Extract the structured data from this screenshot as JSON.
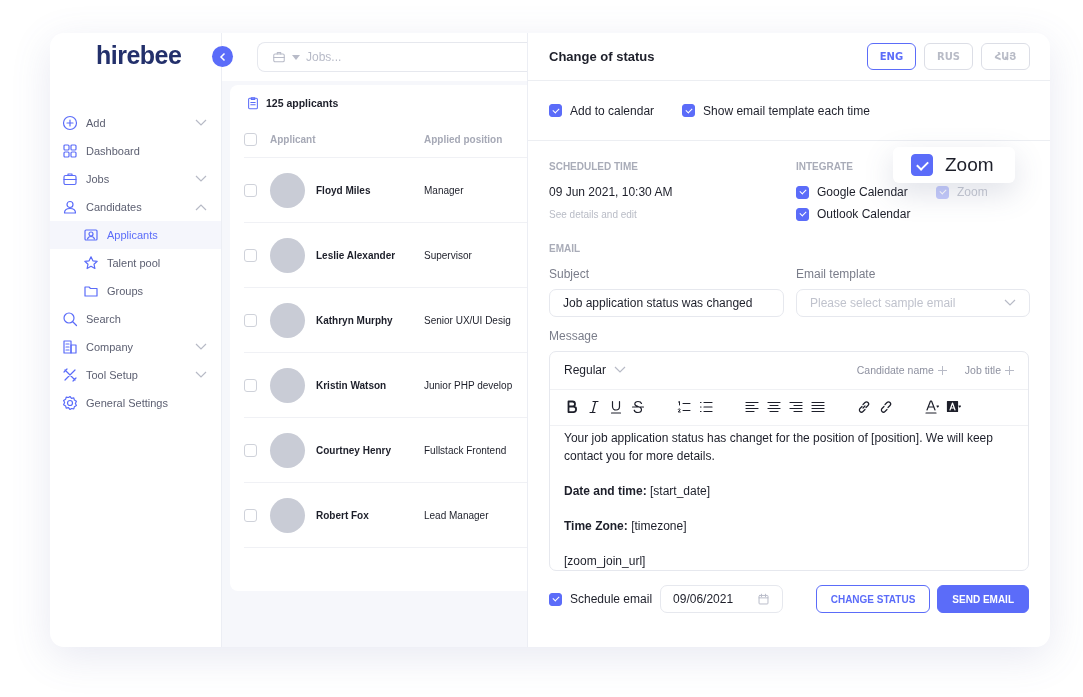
{
  "sidebar": {
    "logo": "hirebee",
    "items": [
      {
        "label": "Add",
        "kind": "group",
        "expanded": false,
        "selected": false
      },
      {
        "label": "Dashboard",
        "kind": "link",
        "selected": false
      },
      {
        "label": "Jobs",
        "kind": "group",
        "expanded": false,
        "selected": false
      },
      {
        "label": "Candidates",
        "kind": "group",
        "expanded": true,
        "selected": false,
        "children": [
          {
            "label": "Applicants",
            "selected": true
          },
          {
            "label": "Talent pool",
            "selected": false
          },
          {
            "label": "Groups",
            "selected": false
          }
        ]
      },
      {
        "label": "Search",
        "kind": "link",
        "selected": false
      },
      {
        "label": "Company",
        "kind": "group",
        "expanded": false,
        "selected": false
      },
      {
        "label": "Tool Setup",
        "kind": "group",
        "expanded": false,
        "selected": false
      },
      {
        "label": "General Settings",
        "kind": "link",
        "selected": false
      }
    ]
  },
  "search": {
    "placeholder": "Jobs..."
  },
  "table": {
    "count": "125 applicants",
    "all_checked": false,
    "columns": [
      "Applicant",
      "Applied position"
    ],
    "rows": [
      {
        "name": "Floyd Miles",
        "position": "Manager",
        "checked": false
      },
      {
        "name": "Leslie Alexander",
        "position": "Supervisor",
        "checked": false
      },
      {
        "name": "Kathryn Murphy",
        "position": "Senior UX/UI Desig",
        "checked": false
      },
      {
        "name": "Kristin Watson",
        "position": "Junior PHP develop",
        "checked": false
      },
      {
        "name": "Courtney Henry",
        "position": "Fullstack Frontend",
        "checked": false
      },
      {
        "name": "Robert Fox",
        "position": "Lead Manager",
        "checked": false
      }
    ]
  },
  "panel": {
    "title": "Change of status",
    "languages": [
      {
        "label": "ENG",
        "selected": true
      },
      {
        "label": "RUS",
        "selected": false
      },
      {
        "label": "ՀԱՅ",
        "selected": false
      }
    ],
    "options": [
      {
        "label": "Add to calendar",
        "checked": true
      },
      {
        "label": "Show email template each time",
        "checked": true
      }
    ],
    "scheduled": {
      "heading": "SCHEDULED TIME",
      "value": "09 Jun 2021, 10:30 AM",
      "link": "See details and edit"
    },
    "integrate": {
      "heading": "INTEGRATE",
      "items": [
        {
          "label": "Google Calendar",
          "checked": true,
          "disabled": false
        },
        {
          "label": "Zoom",
          "checked": true,
          "disabled": true
        },
        {
          "label": "Outlook Calendar",
          "checked": true,
          "disabled": false
        }
      ]
    },
    "zoom_popup": {
      "label": "Zoom",
      "checked": true
    },
    "email": {
      "heading": "EMAIL",
      "subject_label": "Subject",
      "subject": "Job application status was changed",
      "template_label": "Email template",
      "template_placeholder": "Please select sample email",
      "message_label": "Message",
      "format": "Regular",
      "tokens": [
        "Candidate name",
        "Job title"
      ],
      "body": [
        "Your job application status has changet for the position of [position]. We will keep contact you for more details.",
        "**Date and time:** [start_date]",
        "**Time Zone:** [timezone]",
        "[zoom_join_url]"
      ]
    },
    "schedule": {
      "label": "Schedule email",
      "checked": true,
      "date": "09/06/2021"
    },
    "buttons": [
      {
        "label": "CHANGE STATUS",
        "kind": "secondary"
      },
      {
        "label": "SEND EMAIL",
        "kind": "primary"
      }
    ]
  }
}
